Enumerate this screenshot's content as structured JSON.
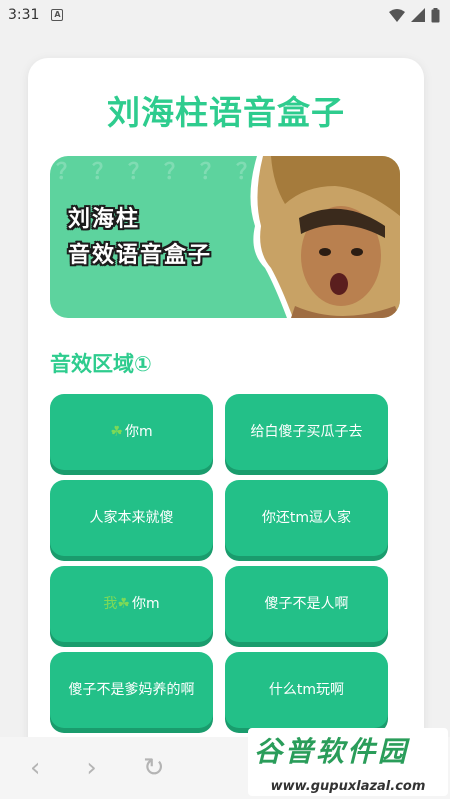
{
  "status_bar": {
    "time": "3:31",
    "app_icon_letter": "A"
  },
  "app": {
    "title": "刘海柱语音盒子"
  },
  "banner": {
    "line1": "刘海柱",
    "line2": "音效语音盒子",
    "pattern": "？？？？？？？？？？？？？？？？？？？？？？？？？？？？？？？？？？？？？？？"
  },
  "section": {
    "title": "音效区域①"
  },
  "buttons": [
    {
      "prefix": "☘",
      "label": "你m"
    },
    {
      "prefix": "",
      "label": "给白傻子买瓜子去"
    },
    {
      "prefix": "",
      "label": "人家本来就傻"
    },
    {
      "prefix": "",
      "label": "你还tm逗人家"
    },
    {
      "prefix": "我☘",
      "label": "你m"
    },
    {
      "prefix": "",
      "label": "傻子不是人啊"
    },
    {
      "prefix": "",
      "label": "傻子不是爹妈养的啊"
    },
    {
      "prefix": "",
      "label": "什么tm玩啊"
    }
  ],
  "nav": {
    "back": "‹",
    "forward": "›",
    "refresh": "↻"
  },
  "watermark": {
    "title": "谷普软件园",
    "url": "www.gupuxlazal.com"
  },
  "colors": {
    "accent": "#2ecc8e",
    "button": "#23c088",
    "button_shadow": "#1a9c6d"
  }
}
